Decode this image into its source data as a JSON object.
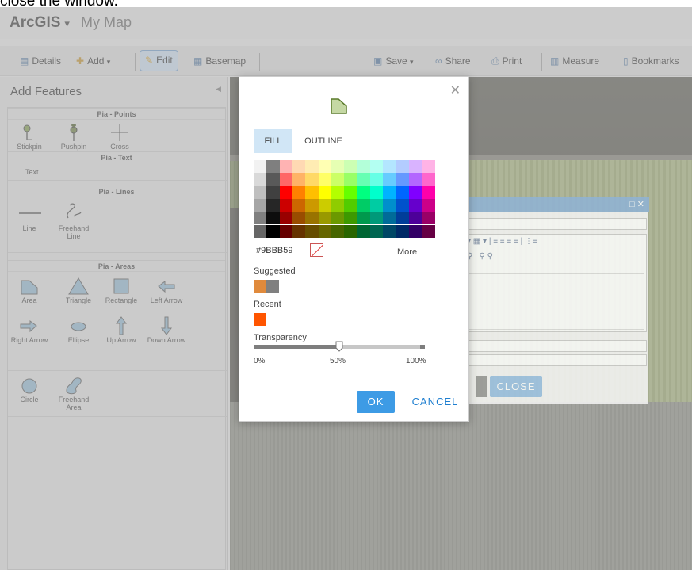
{
  "caption": "close the window.",
  "header": {
    "brand": "ArcGIS",
    "map_title": "My Map"
  },
  "toolbar": {
    "details": "Details",
    "add": "Add",
    "edit": "Edit",
    "basemap": "Basemap",
    "save": "Save",
    "share": "Share",
    "print": "Print",
    "measure": "Measure",
    "bookmarks": "Bookmarks"
  },
  "left_panel": {
    "title": "Add Features",
    "groups": [
      "Pia - Points",
      "Pia - Text",
      "Pia - Lines",
      "Pia - Areas"
    ],
    "points": [
      "Stickpin",
      "Pushpin",
      "Cross"
    ],
    "text": [
      "Text"
    ],
    "lines": [
      "Line",
      "Freehand Line"
    ],
    "areas": [
      "Area",
      "Triangle",
      "Rectangle",
      "Left Arrow",
      "Right Arrow",
      "Ellipse",
      "Up Arrow",
      "Down Arrow",
      "Circle",
      "Freehand Area"
    ]
  },
  "background_dialog": {
    "close": "CLOSE"
  },
  "color_dialog": {
    "tabs": [
      "FILL",
      "OUTLINE"
    ],
    "active_tab": "FILL",
    "hex_value": "#9BBB59",
    "more": "More",
    "suggested_label": "Suggested",
    "recent_label": "Recent",
    "transparency_label": "Transparency",
    "transparency_value": 0.5,
    "ticks": [
      "0%",
      "50%",
      "100%"
    ],
    "ok": "OK",
    "cancel": "CANCEL",
    "preview_color": "#c5d8a4",
    "suggested_colors": [
      "#e08a3c",
      "#808080"
    ],
    "recent_colors": [
      "#ff5500"
    ],
    "grayscale": [
      [
        "#f2f2f2",
        "#7f7f7f"
      ],
      [
        "#d9d9d9",
        "#595959"
      ],
      [
        "#bfbfbf",
        "#404040"
      ],
      [
        "#a6a6a6",
        "#262626"
      ],
      [
        "#808080",
        "#0d0d0d"
      ],
      [
        "#666666",
        "#000000"
      ]
    ],
    "palette": [
      [
        "#ffb3b3",
        "#ffd9b3",
        "#ffecb3",
        "#ffffb3",
        "#e6ffb3",
        "#ccffb3",
        "#b3ffd9",
        "#b3fff2",
        "#b3e6ff",
        "#b3ccff",
        "#d9b3ff",
        "#ffb3e6"
      ],
      [
        "#ff6666",
        "#ffb366",
        "#ffd966",
        "#ffff66",
        "#ccff66",
        "#99ff66",
        "#66ffb3",
        "#66ffe6",
        "#66ccff",
        "#6699ff",
        "#b366ff",
        "#ff66cc"
      ],
      [
        "#ff0000",
        "#ff8000",
        "#ffbf00",
        "#ffff00",
        "#b3ff00",
        "#66ff00",
        "#00ff80",
        "#00ffcc",
        "#00b3ff",
        "#0066ff",
        "#8000ff",
        "#ff00aa"
      ],
      [
        "#cc0000",
        "#cc6600",
        "#cc9900",
        "#cccc00",
        "#8fcc00",
        "#52cc00",
        "#00cc66",
        "#00cca3",
        "#008fcc",
        "#0052cc",
        "#6600cc",
        "#cc0088"
      ],
      [
        "#990000",
        "#994d00",
        "#997300",
        "#999900",
        "#6b9900",
        "#3d9900",
        "#00994d",
        "#00997a",
        "#006b99",
        "#003d99",
        "#4d0099",
        "#990066"
      ],
      [
        "#660000",
        "#663300",
        "#664d00",
        "#666600",
        "#476600",
        "#296600",
        "#006633",
        "#006652",
        "#004766",
        "#002966",
        "#330066",
        "#660044"
      ]
    ]
  }
}
